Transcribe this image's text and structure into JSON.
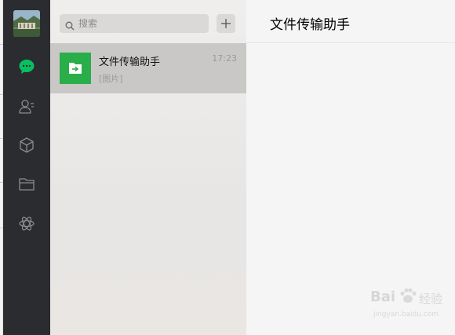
{
  "sidebar": {
    "avatar_label": "user-avatar",
    "items": [
      {
        "name": "chat",
        "icon": "chat-bubble-icon",
        "active": true
      },
      {
        "name": "contacts",
        "icon": "contacts-icon"
      },
      {
        "name": "favorites",
        "icon": "cube-icon"
      },
      {
        "name": "files",
        "icon": "folder-icon"
      },
      {
        "name": "mini-programs",
        "icon": "mini-program-icon"
      }
    ],
    "active_color": "#07c160",
    "icon_color": "#8c8c8c"
  },
  "search": {
    "placeholder": "搜索"
  },
  "chat_list": [
    {
      "name": "文件传输助手",
      "time": "17:23",
      "preview": "[图片]",
      "selected": true,
      "avatar_color": "#2aae49",
      "icon": "file-transfer-icon"
    }
  ],
  "main": {
    "title": "文件传输助手"
  },
  "watermark": {
    "brand": "Bai",
    "brand_suffix": "经验",
    "url": "jingyan.baidu.com"
  }
}
